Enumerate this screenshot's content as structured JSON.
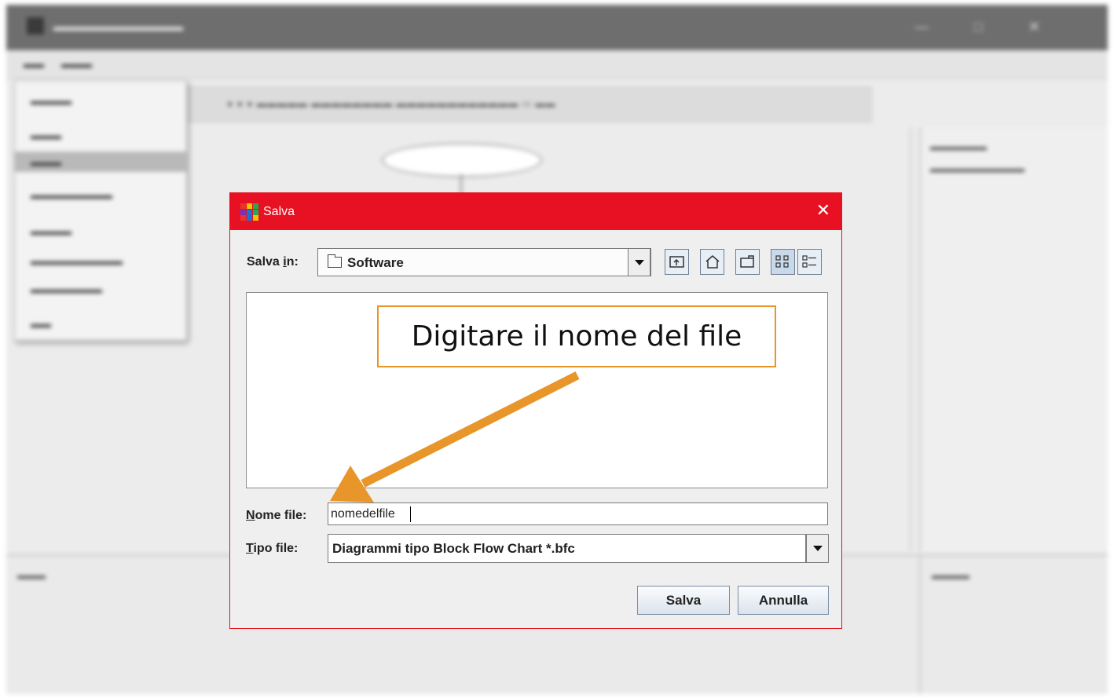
{
  "dialog": {
    "title": "Salva",
    "close_glyph": "✕",
    "save_in_label_prefix": "Salva ",
    "save_in_label_mnemonic": "i",
    "save_in_label_suffix": "n:",
    "save_in_value": "Software",
    "toolbar_icons": [
      "up-one-level-icon",
      "home-icon",
      "new-folder-icon",
      "list-view-icon",
      "details-view-icon"
    ],
    "file_name_label_mnemonic": "N",
    "file_name_label_rest": "ome file:",
    "file_name_value": "nomedelfile",
    "file_type_label_mnemonic": "T",
    "file_type_label_rest": "ipo file:",
    "file_type_value": "Diagrammi tipo Block Flow Chart *.bfc",
    "save_button": "Salva",
    "cancel_button": "Annulla"
  },
  "annotation": {
    "callout_text": "Digitare il nome del file",
    "arrow_color": "#e8952a"
  },
  "colors": {
    "titlebar": "#e81123",
    "dialog_bg": "#efefef",
    "accent_orange": "#e8952a"
  }
}
